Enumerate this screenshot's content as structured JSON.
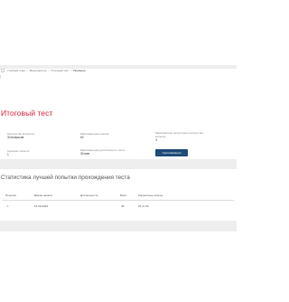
{
  "breadcrumb": {
    "items": [
      "Учебный план",
      "Мероприятие",
      "Итоговый тест"
    ],
    "current": "Просмотр"
  },
  "title": "Итоговый тест",
  "info": {
    "questions_label": "Количество вопросов",
    "questions_value": "30 вопросов",
    "max_score_label": "Максимальная оценка",
    "max_score_value": "60",
    "max_attempts_label": "Максимально допустимое количество попыток",
    "max_attempts_value": "3",
    "attempts_used_label": "Сделано попыток",
    "attempts_used_value": "1",
    "max_duration_label": "Максимальная длительность теста",
    "max_duration_value": "30 мин."
  },
  "actions": {
    "certification_label": "Сертификация"
  },
  "best_attempt": {
    "title": "Статистика лучшей попытки прохождения теста",
    "columns": [
      "Попытки",
      "Время начала",
      "Длительность",
      "Балл",
      "Корректные ответы"
    ],
    "rows": [
      [
        "1",
        "15.09.2023",
        "",
        "46",
        "23 из 30"
      ]
    ]
  },
  "colors": {
    "title": "#d8263b",
    "button": "#1f4c7a",
    "band": "#eeeeee"
  }
}
